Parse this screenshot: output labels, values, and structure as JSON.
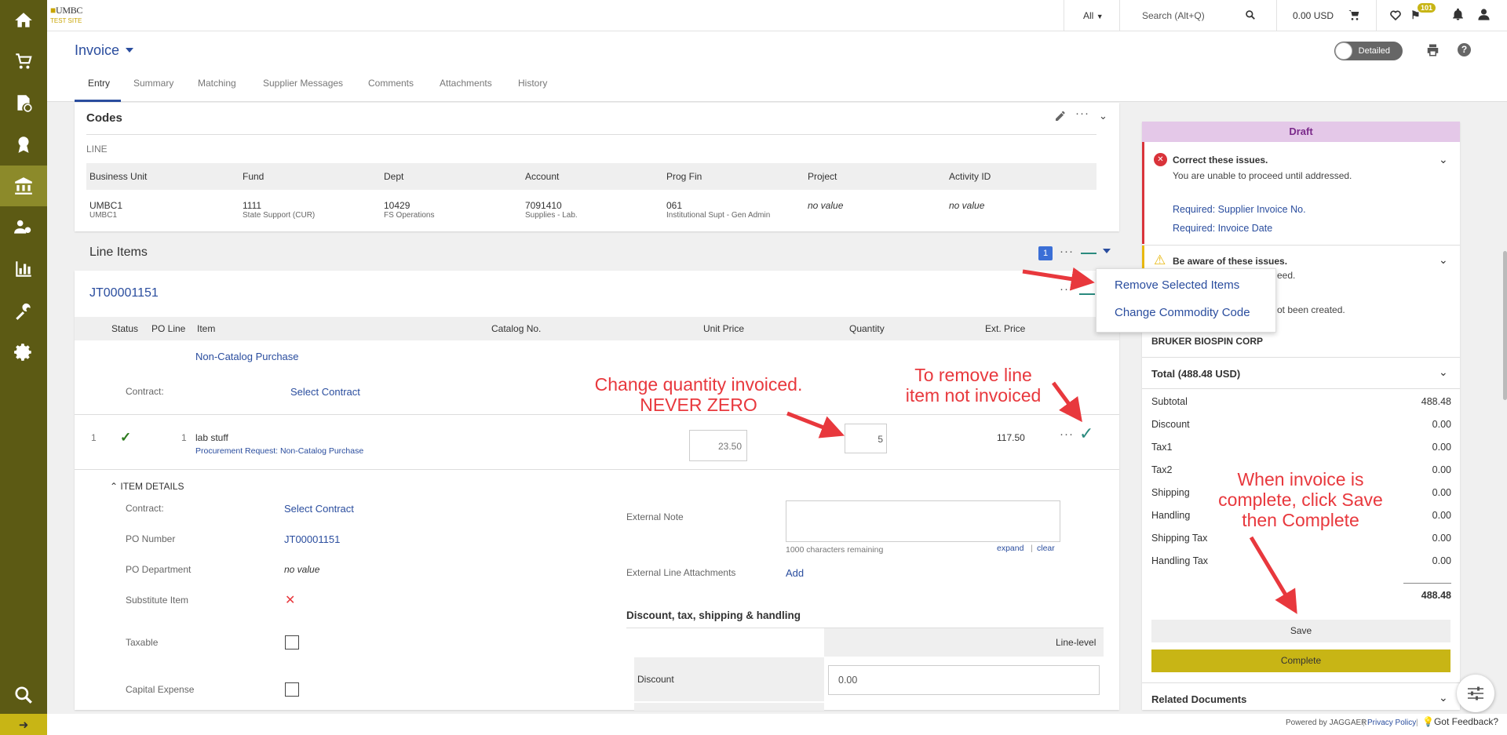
{
  "app": {
    "brand": "UMBC",
    "site": "TEST SITE"
  },
  "topbar": {
    "scope": "All",
    "search_placeholder": "Search (Alt+Q)",
    "cart_total": "0.00 USD",
    "notif_count": "101"
  },
  "sidebar": {
    "items": [
      {
        "icon": "home-icon"
      },
      {
        "icon": "cart-icon"
      },
      {
        "icon": "document-clock-icon"
      },
      {
        "icon": "award-icon"
      },
      {
        "icon": "bank-icon"
      },
      {
        "icon": "users-gear-icon"
      },
      {
        "icon": "bar-chart-icon"
      },
      {
        "icon": "wrench-gear-icon"
      },
      {
        "icon": "gear-icon"
      },
      {
        "icon": "search-icon"
      }
    ]
  },
  "header": {
    "title": "Invoice",
    "toggle_label": "Detailed",
    "tabs": [
      "Entry",
      "Summary",
      "Matching",
      "Supplier Messages",
      "Comments",
      "Attachments",
      "History"
    ]
  },
  "codes": {
    "title": "Codes",
    "section": "LINE",
    "columns": [
      "Business Unit",
      "Fund",
      "Dept",
      "Account",
      "Prog Fin",
      "Project",
      "Activity ID"
    ],
    "values": [
      {
        "main": "UMBC1",
        "sub": "UMBC1"
      },
      {
        "main": "1111",
        "sub": "State Support (CUR)"
      },
      {
        "main": "10429",
        "sub": "FS Operations"
      },
      {
        "main": "7091410",
        "sub": "Supplies - Lab."
      },
      {
        "main": "061",
        "sub": "Institutional Supt - Gen Admin"
      },
      {
        "main": "no value",
        "sub": ""
      },
      {
        "main": "no value",
        "sub": ""
      }
    ]
  },
  "line_items": {
    "title": "Line Items",
    "selected_count": "1",
    "po_number": "JT00001151",
    "columns": [
      "Status",
      "PO Line",
      "Item",
      "Catalog No.",
      "Unit Price",
      "Quantity",
      "Ext. Price"
    ],
    "group_label": "Non-Catalog Purchase",
    "contract_label": "Contract:",
    "select_contract": "Select Contract",
    "row": {
      "num": "1",
      "po_line": "1",
      "item": "lab stuff",
      "item_sub": "Procurement Request: Non-Catalog Purchase",
      "unit_price": "23.50",
      "quantity": "5",
      "ext_price": "117.50"
    },
    "menu": [
      "Remove Selected Items",
      "Change Commodity Code"
    ]
  },
  "item_details": {
    "title": "ITEM DETAILS",
    "contract_label": "Contract:",
    "contract_value": "Select Contract",
    "po_number_label": "PO Number",
    "po_number_value": "JT00001151",
    "po_dept_label": "PO Department",
    "po_dept_value": "no value",
    "substitute_label": "Substitute Item",
    "taxable_label": "Taxable",
    "capital_label": "Capital Expense",
    "ext_note_label": "External Note",
    "chars_remaining": "1000 characters remaining",
    "expand": "expand",
    "clear": "clear",
    "attachments_label": "External Line Attachments",
    "add": "Add",
    "discount_section": "Discount, tax, shipping & handling",
    "line_level": "Line-level",
    "discount_label": "Discount",
    "discount_value": "0.00"
  },
  "right_panel": {
    "status": "Draft",
    "issues_title": "Correct these issues.",
    "issues_sub": "You are unable to proceed until addressed.",
    "issue_links": [
      "Required: Supplier Invoice No.",
      "Required: Invoice Date"
    ],
    "warnings_title": "Be aware of these issues.",
    "warn_frag1": "eed.",
    "warn_frag2": "ot been created.",
    "supplier": "BRUKER BIOSPIN CORP",
    "total_title": "Total (488.48 USD)",
    "totals": [
      {
        "label": "Subtotal",
        "value": "488.48"
      },
      {
        "label": "Discount",
        "value": "0.00"
      },
      {
        "label": "Tax1",
        "value": "0.00"
      },
      {
        "label": "Tax2",
        "value": "0.00"
      },
      {
        "label": "Shipping",
        "value": "0.00"
      },
      {
        "label": "Handling",
        "value": "0.00"
      },
      {
        "label": "Shipping Tax",
        "value": "0.00"
      },
      {
        "label": "Handling Tax",
        "value": "0.00"
      }
    ],
    "grand_total": "488.48",
    "save": "Save",
    "complete": "Complete",
    "related": "Related Documents"
  },
  "annotations": {
    "qty_line1": "Change quantity invoiced.",
    "qty_line2": "NEVER ZERO",
    "remove_line1": "To remove line",
    "remove_line2": "item not invoiced",
    "save_line1": "When invoice is",
    "save_line2": "complete, click Save",
    "save_line3": "then Complete"
  },
  "footer": {
    "powered": "Powered by JAGGAER",
    "privacy": "Privacy Policy",
    "feedback": "Got Feedback?"
  },
  "colors": {
    "sidebar": "#5c5a14",
    "accent_gold": "#c8b515",
    "link": "#2a4d9e",
    "annotation_red": "#e8383d",
    "draft_bg": "#e4c8e8"
  }
}
